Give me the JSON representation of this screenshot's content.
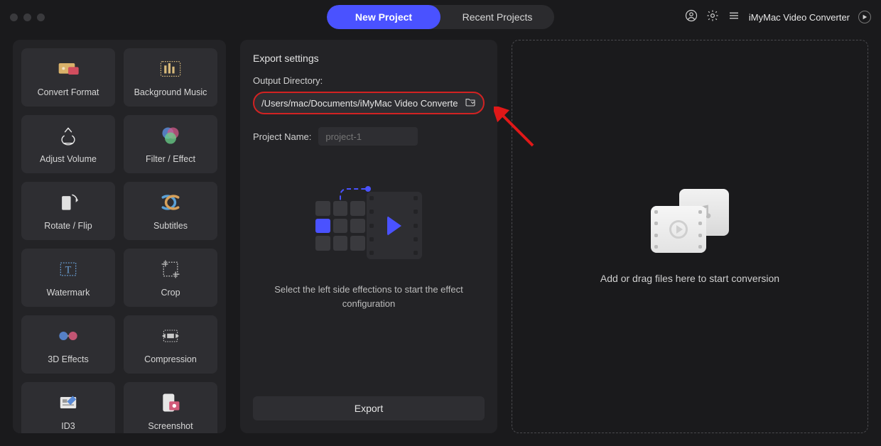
{
  "app": {
    "name": "iMyMac Video Converter"
  },
  "tabs": {
    "new_project": "New Project",
    "recent_projects": "Recent Projects"
  },
  "effects": [
    {
      "id": "convert-format",
      "label": "Convert Format"
    },
    {
      "id": "background-music",
      "label": "Background Music"
    },
    {
      "id": "adjust-volume",
      "label": "Adjust Volume"
    },
    {
      "id": "filter-effect",
      "label": "Filter / Effect"
    },
    {
      "id": "rotate-flip",
      "label": "Rotate / Flip"
    },
    {
      "id": "subtitles",
      "label": "Subtitles"
    },
    {
      "id": "watermark",
      "label": "Watermark"
    },
    {
      "id": "crop",
      "label": "Crop"
    },
    {
      "id": "3d-effects",
      "label": "3D Effects"
    },
    {
      "id": "compression",
      "label": "Compression"
    },
    {
      "id": "id3",
      "label": "ID3"
    },
    {
      "id": "screenshot",
      "label": "Screenshot"
    }
  ],
  "export": {
    "title": "Export settings",
    "output_dir_label": "Output Directory:",
    "output_dir_path": "/Users/mac/Documents/iMyMac Video Converte",
    "project_name_label": "Project Name:",
    "project_name_placeholder": "project-1",
    "hint": "Select the left side effections to start the effect configuration",
    "button": "Export"
  },
  "drop": {
    "text": "Add or drag files here to start conversion"
  }
}
